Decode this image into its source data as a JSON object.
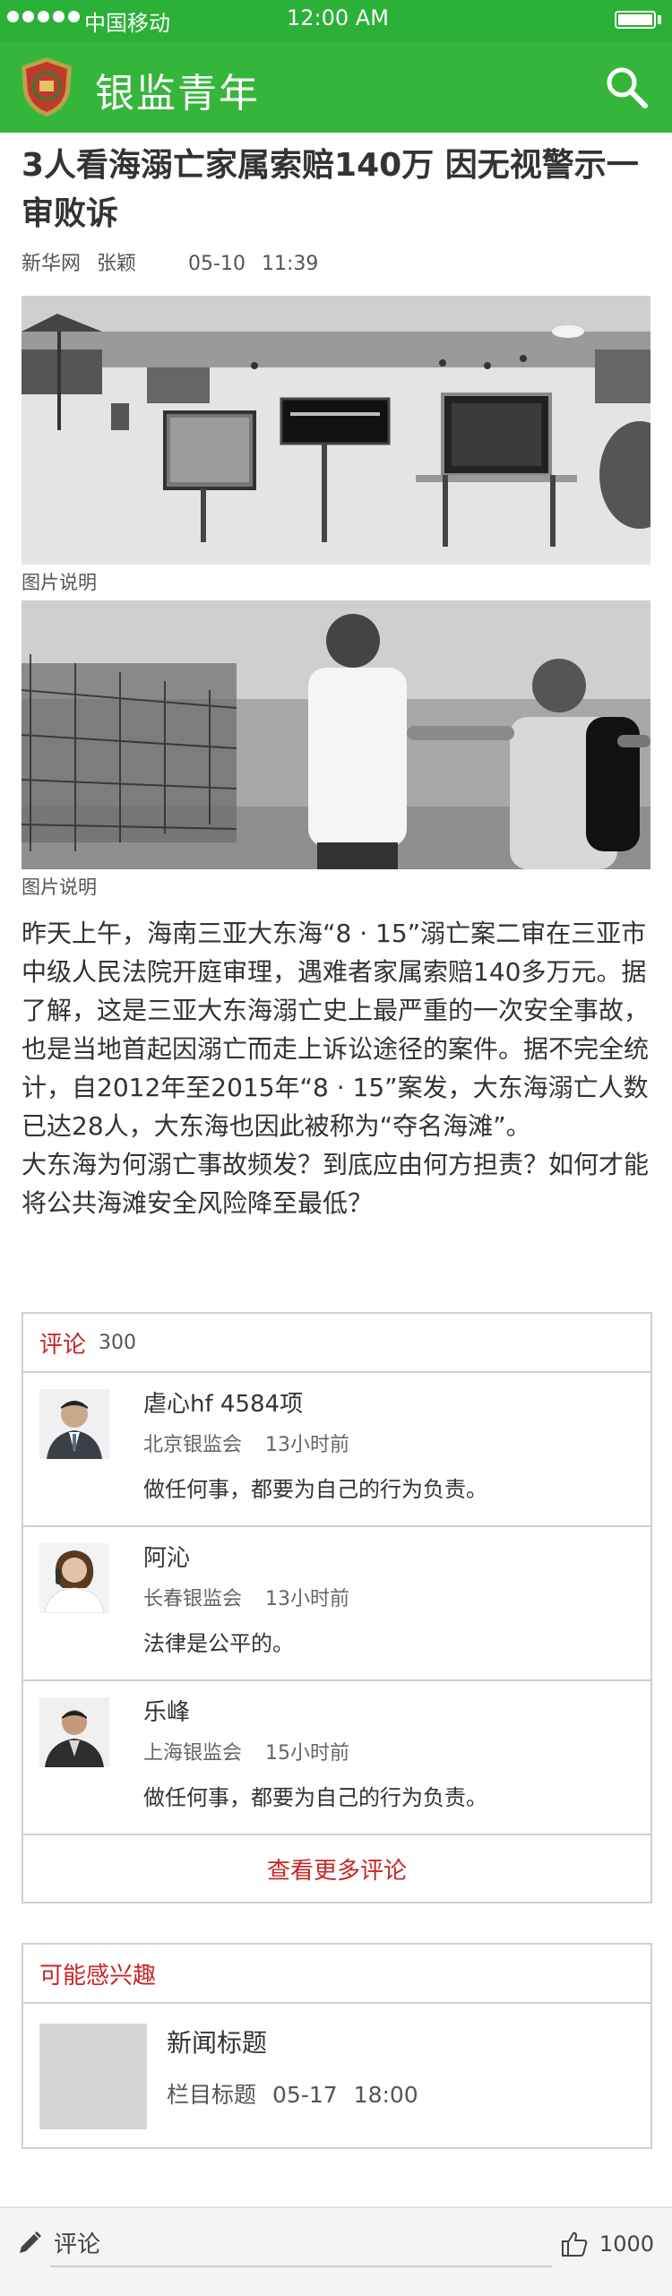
{
  "status": {
    "carrier": "中国移动",
    "time": "12:00 AM"
  },
  "app": {
    "title": "银监青年"
  },
  "article": {
    "title": "3人看海溺亡家属索赔140万 因无视警示一审败诉",
    "source": "新华网",
    "author": "张颖",
    "date": "05-10",
    "time": "11:39",
    "captions": [
      "图片说明",
      "图片说明"
    ],
    "paragraphs": [
      "昨天上午，海南三亚大东海“8 · 15”溺亡案二审在三亚市中级人民法院开庭审理，遇难者家属索赔140多万元。据了解，这是三亚大东海溺亡史上最严重的一次安全事故，也是当地首起因溺亡而走上诉讼途径的案件。据不完全统计，自2012年至2015年“8 · 15”案发，大东海溺亡人数已达28人，大东海也因此被称为“夺名海滩”。",
      "大东海为何溺亡事故频发？到底应由何方担责？如何才能将公共海滩安全风险降至最低？"
    ]
  },
  "comments": {
    "label": "评论",
    "count": "300",
    "items": [
      {
        "user": "虐心hf 4584项",
        "org": "北京银监会",
        "time": "13小时前",
        "text": "做任何事，都要为自己的行为负责。"
      },
      {
        "user": "阿沁",
        "org": "长春银监会",
        "time": "13小时前",
        "text": "法律是公平的。"
      },
      {
        "user": "乐峰",
        "org": "上海银监会",
        "time": "15小时前",
        "text": "做任何事，都要为自己的行为负责。"
      }
    ],
    "more_label": "查看更多评论"
  },
  "related": {
    "label": "可能感兴趣",
    "items": [
      {
        "title": "新闻标题",
        "column": "栏目标题",
        "date": "05-17",
        "time": "18:00"
      }
    ]
  },
  "bottom": {
    "comment_label": "评论",
    "likes": "1000"
  },
  "colors": {
    "brand_green": "#35b63b",
    "accent_red": "#c62828"
  },
  "icons": [
    "search-icon",
    "pencil-icon",
    "thumbs-up-icon",
    "shield-logo"
  ]
}
